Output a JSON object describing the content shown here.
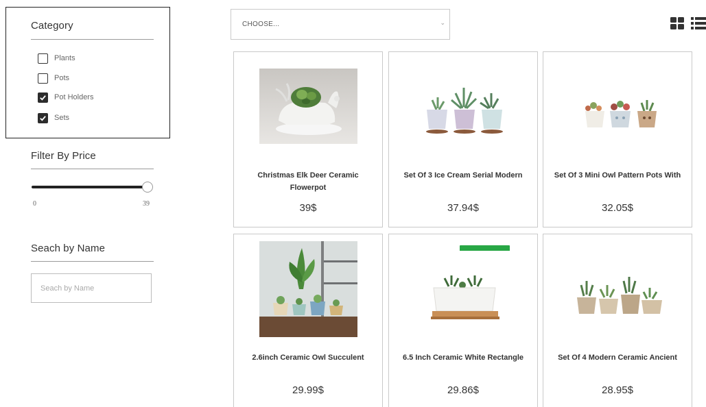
{
  "sidebar": {
    "category": {
      "title": "Category",
      "items": [
        {
          "label": "Plants",
          "checked": false
        },
        {
          "label": "Pots",
          "checked": false
        },
        {
          "label": "Pot Holders",
          "checked": true
        },
        {
          "label": "Sets",
          "checked": true
        }
      ]
    },
    "price": {
      "title": "Filter By Price",
      "min": "0",
      "max": "39",
      "value": 1.0
    },
    "name": {
      "title": "Seach by Name",
      "placeholder": "Seach by Name"
    }
  },
  "toolbar": {
    "sort_label": "CHOOSE..."
  },
  "products": [
    {
      "name": "Christmas Elk Deer Ceramic Flowerpot",
      "price": "39$"
    },
    {
      "name": "Set Of 3 Ice Cream Serial Modern",
      "price": "37.94$"
    },
    {
      "name": "Set Of 3 Mini Owl Pattern Pots With",
      "price": "32.05$"
    },
    {
      "name": "2.6inch Ceramic Owl Succulent",
      "price": "29.99$"
    },
    {
      "name": "6.5 Inch Ceramic White Rectangle",
      "price": "29.86$"
    },
    {
      "name": "Set Of 4 Modern Ceramic Ancient",
      "price": "28.95$"
    }
  ]
}
